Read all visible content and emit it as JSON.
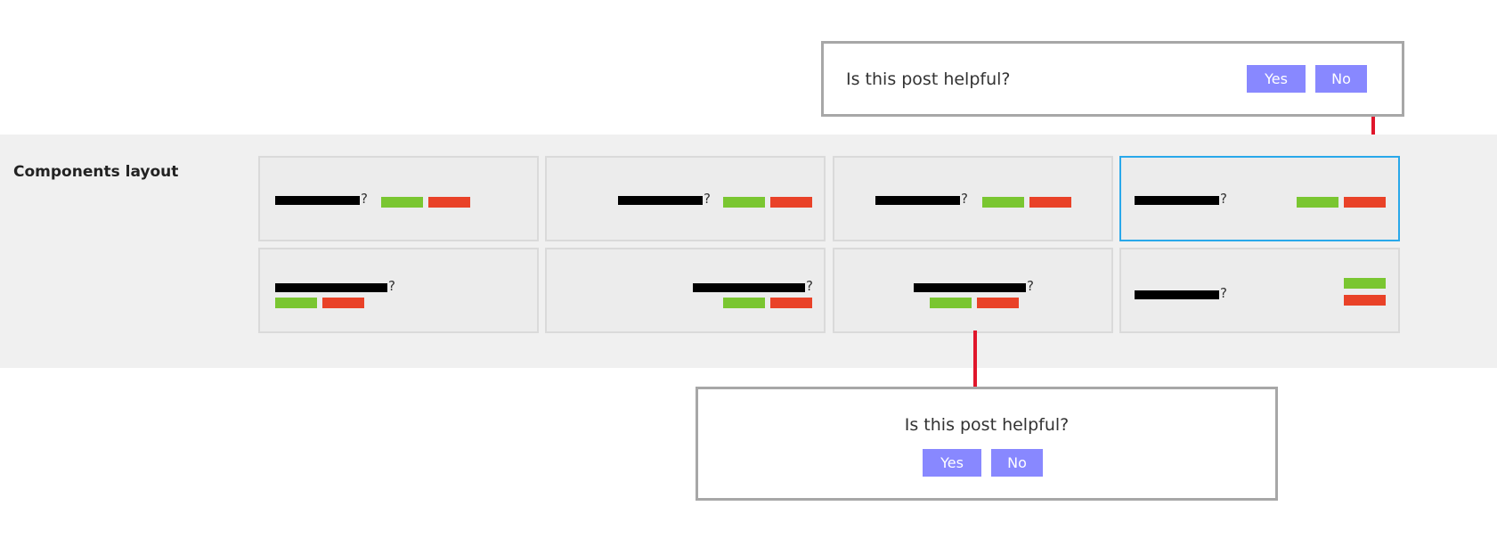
{
  "section": {
    "title": "Components layout"
  },
  "tile_glyph": {
    "question_mark": "?"
  },
  "previews": {
    "top": {
      "question": "Is this post helpful?",
      "yes": "Yes",
      "no": "No"
    },
    "bottom": {
      "question": "Is this post helpful?",
      "yes": "Yes",
      "no": "No"
    }
  },
  "colors": {
    "accent_selected": "#29a8ea",
    "button_yes_thumb": "#7ac631",
    "button_no_thumb": "#e94228",
    "preview_button": "#8888ff",
    "connector": "#e0162b"
  },
  "icons": [
    "question-bar-icon",
    "yes-swatch-icon",
    "no-swatch-icon"
  ]
}
